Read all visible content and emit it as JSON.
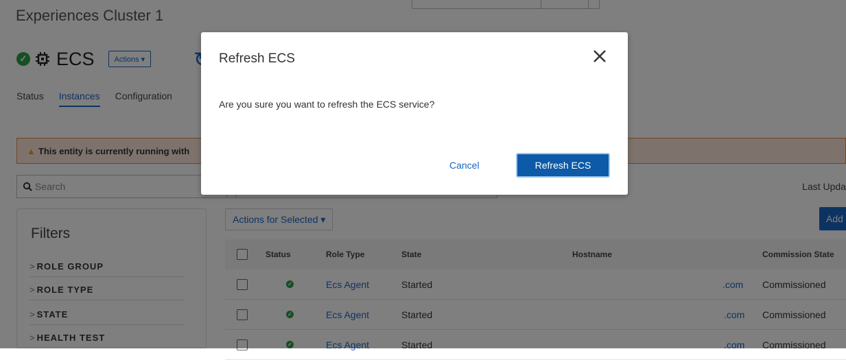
{
  "header": {
    "cluster_title": "Experiences Cluster 1"
  },
  "service": {
    "name": "ECS",
    "actions_label": "Actions ▾",
    "status": "ok"
  },
  "tabs": [
    {
      "label": "Status"
    },
    {
      "label": "Instances",
      "active": true
    },
    {
      "label": "Configuration"
    }
  ],
  "warning": {
    "text": "This entity is currently running with"
  },
  "search": {
    "placeholder": "Search"
  },
  "last_updated_label": "Last Upda",
  "filters": {
    "title": "Filters",
    "items": [
      {
        "label": "ROLE GROUP"
      },
      {
        "label": "ROLE TYPE"
      },
      {
        "label": "STATE"
      },
      {
        "label": "HEALTH TEST"
      }
    ]
  },
  "toolbar": {
    "actions_for_selected": "Actions for Selected ▾",
    "add_label": "Add"
  },
  "table": {
    "columns": [
      "Status",
      "Role Type",
      "State",
      "Hostname",
      "Commission State"
    ],
    "rows": [
      {
        "role_type": "Ecs Agent",
        "state": "Started",
        "hostname_suffix": ".com",
        "commission_state": "Commissioned"
      },
      {
        "role_type": "Ecs Agent",
        "state": "Started",
        "hostname_suffix": ".com",
        "commission_state": "Commissioned"
      },
      {
        "role_type": "Ecs Agent",
        "state": "Started",
        "hostname_suffix": ".com",
        "commission_state": "Commissioned"
      }
    ]
  },
  "modal": {
    "title": "Refresh ECS",
    "body": "Are you sure you want to refresh the ECS service?",
    "cancel_label": "Cancel",
    "confirm_label": "Refresh ECS"
  },
  "colors": {
    "accent": "#1a66c4",
    "success": "#2e9e4a",
    "warning_border": "#e8893b",
    "primary_button": "#0c5aa8"
  }
}
